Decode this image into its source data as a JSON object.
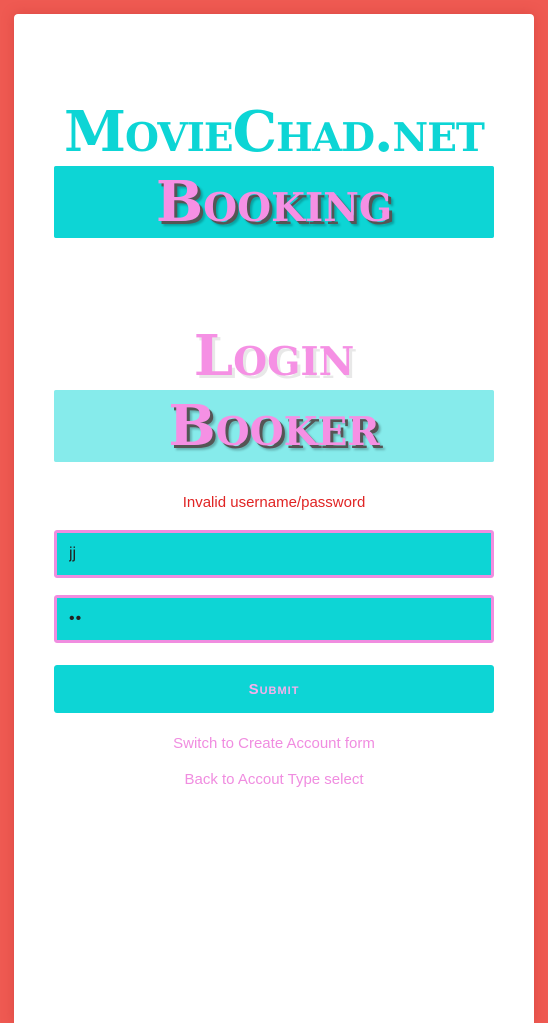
{
  "header": {
    "site_title": "MovieChad.net",
    "section_banner": "Booking"
  },
  "login": {
    "title": "Login",
    "account_type_banner": "Booker",
    "error_message": "Invalid username/password",
    "username_value": "jj",
    "password_value": "••"
  },
  "form": {
    "submit_label": "Submit"
  },
  "links": {
    "create_account": "Switch to Create Account form",
    "back_to_account_type": "Back to Accout Type select"
  },
  "colors": {
    "background": "#ef5a52",
    "accent_cyan": "#0dd5d5",
    "accent_pink": "#f08de0",
    "error_red": "#e02424"
  }
}
